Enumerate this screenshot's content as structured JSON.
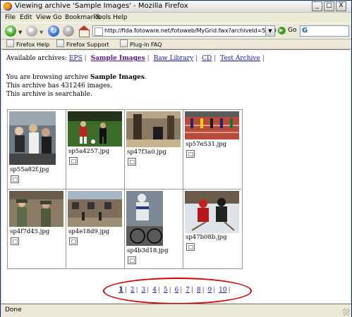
{
  "window": {
    "title": "Viewing archive 'Sample Images' - Mozilla Firefox",
    "controls": [
      "_",
      "□",
      "X"
    ]
  },
  "menu": [
    "File",
    "Edit",
    "View",
    "Go",
    "Bookmarks",
    "Tools",
    "Help"
  ],
  "navigation": {
    "url": "http://fida.fotoware.net/fotoweb/MyGrid.fwx?archiveId=5000",
    "go_label": "Go",
    "search_placeholder": ""
  },
  "bookmarks": [
    "Firefox Help",
    "Firefox Support",
    "Plug-in FAQ"
  ],
  "archives": {
    "label": "Available archives:",
    "items": [
      "EPS",
      "Sample Images",
      "Raw Library",
      "CD",
      "Test Archive"
    ],
    "current": "Sample Images"
  },
  "info": {
    "line1_prefix": "You are browsing archive ",
    "line1_archive": "Sample Images",
    "line1_suffix": ".",
    "line2": "This archive has 431246 images.",
    "line3": "This archive is searchable."
  },
  "images": [
    {
      "filename": "sp55a82f.jpg",
      "icon": "photo-parade-crowd"
    },
    {
      "filename": "sp5a4257.jpg",
      "icon": "photo-soccer-players"
    },
    {
      "filename": "sp47f3a0.jpg",
      "icon": "photo-people-legs"
    },
    {
      "filename": "sp57e531.jpg",
      "icon": "photo-track-runners"
    },
    {
      "filename": "sp4f7d45.jpg",
      "icon": "photo-soldiers"
    },
    {
      "filename": "sp4e18d9.jpg",
      "icon": "photo-building-people"
    },
    {
      "filename": "sp4b3d18.jpg",
      "icon": "photo-cyclist"
    },
    {
      "filename": "sp47b08b.jpg",
      "icon": "photo-ice-hockey"
    }
  ],
  "pagination": {
    "pages": [
      "1",
      "2",
      "3",
      "4",
      "5",
      "6",
      "7",
      "8",
      "9",
      "10"
    ],
    "current": "1"
  },
  "status": "Done"
}
